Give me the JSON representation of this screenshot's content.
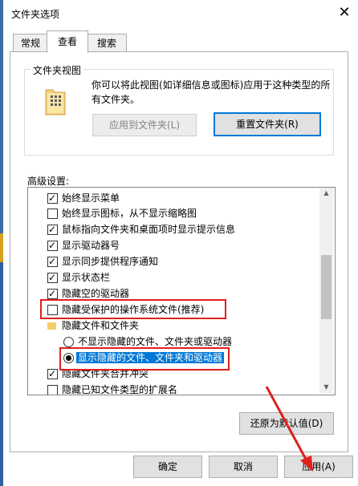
{
  "window": {
    "title": "文件夹选项",
    "close_glyph": "✕"
  },
  "tabs": [
    {
      "label": "常规"
    },
    {
      "label": "查看"
    },
    {
      "label": "搜索"
    }
  ],
  "folder_views": {
    "legend": "文件夹视图",
    "description": "你可以将此视图(如详细信息或图标)应用于这种类型的所有文件夹。",
    "apply_label": "应用到文件夹(L)",
    "reset_label": "重置文件夹(R)"
  },
  "advanced": {
    "label": "高级设置:",
    "items": [
      {
        "type": "checkbox",
        "checked": true,
        "label": "始终显示菜单"
      },
      {
        "type": "checkbox",
        "checked": false,
        "label": "始终显示图标，从不显示缩略图"
      },
      {
        "type": "checkbox",
        "checked": true,
        "label": "鼠标指向文件夹和桌面项时显示提示信息"
      },
      {
        "type": "checkbox",
        "checked": true,
        "label": "显示驱动器号"
      },
      {
        "type": "checkbox",
        "checked": true,
        "label": "显示同步提供程序通知"
      },
      {
        "type": "checkbox",
        "checked": true,
        "label": "显示状态栏"
      },
      {
        "type": "checkbox",
        "checked": true,
        "label": "隐藏空的驱动器"
      },
      {
        "type": "checkbox",
        "checked": false,
        "label": "隐藏受保护的操作系统文件(推荐)"
      },
      {
        "type": "folder",
        "label": "隐藏文件和文件夹"
      },
      {
        "type": "radio",
        "checked": false,
        "label": "不显示隐藏的文件、文件夹或驱动器"
      },
      {
        "type": "radio",
        "checked": true,
        "label": "显示隐藏的文件、文件夹和驱动器"
      },
      {
        "type": "checkbox",
        "checked": true,
        "label": "隐藏文件夹合并冲突"
      },
      {
        "type": "checkbox",
        "checked": false,
        "label": "隐藏已知文件类型的扩展名"
      }
    ],
    "restore_label": "还原为默认值(D)"
  },
  "footer": {
    "ok_label": "确定",
    "cancel_label": "取消",
    "apply_label": "应用(A)"
  },
  "colors": {
    "accent": "#0078d7",
    "annotation_red": "#e0201d"
  }
}
